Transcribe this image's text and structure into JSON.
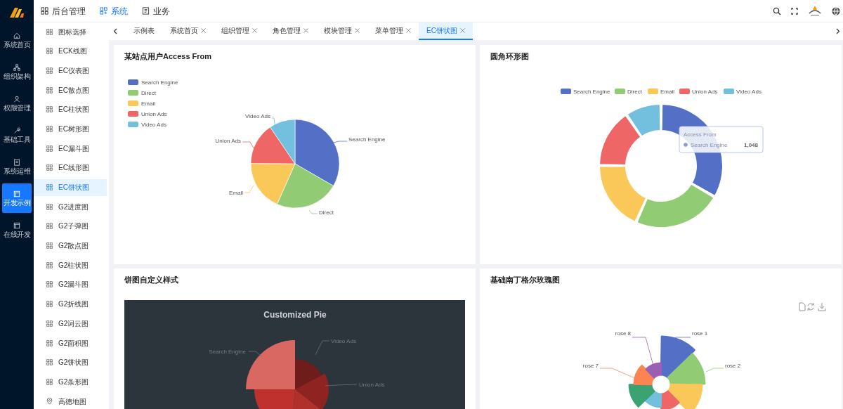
{
  "header": {
    "nav": [
      {
        "label": "后台管理",
        "selected": false
      },
      {
        "label": "系统",
        "selected": true
      },
      {
        "label": "业务",
        "selected": false
      }
    ]
  },
  "sidebar": {
    "items": [
      {
        "label": "系统首页",
        "selected": false
      },
      {
        "label": "组织架构",
        "selected": false
      },
      {
        "label": "权限管理",
        "selected": false
      },
      {
        "label": "基础工具",
        "selected": false
      },
      {
        "label": "系统运维",
        "selected": false
      },
      {
        "label": "开发示例",
        "selected": true
      },
      {
        "label": "在线开发",
        "selected": false
      }
    ]
  },
  "submenu": {
    "items": [
      {
        "label": "图标选择",
        "kind": "chart",
        "selected": false
      },
      {
        "label": "ECK线图",
        "kind": "chart",
        "selected": false
      },
      {
        "label": "EC仪表图",
        "kind": "chart",
        "selected": false
      },
      {
        "label": "EC散点图",
        "kind": "chart",
        "selected": false
      },
      {
        "label": "EC柱状图",
        "kind": "chart",
        "selected": false
      },
      {
        "label": "EC树形图",
        "kind": "chart",
        "selected": false
      },
      {
        "label": "EC漏斗图",
        "kind": "chart",
        "selected": false
      },
      {
        "label": "EC线形图",
        "kind": "chart",
        "selected": false
      },
      {
        "label": "EC饼状图",
        "kind": "chart",
        "selected": true
      },
      {
        "label": "G2进度图",
        "kind": "chart",
        "selected": false
      },
      {
        "label": "G2子弹图",
        "kind": "chart",
        "selected": false
      },
      {
        "label": "G2散点图",
        "kind": "chart",
        "selected": false
      },
      {
        "label": "G2柱状图",
        "kind": "chart",
        "selected": false
      },
      {
        "label": "G2漏斗图",
        "kind": "chart",
        "selected": false
      },
      {
        "label": "G2折线图",
        "kind": "chart",
        "selected": false
      },
      {
        "label": "G2词云图",
        "kind": "chart",
        "selected": false
      },
      {
        "label": "G2面积图",
        "kind": "chart",
        "selected": false
      },
      {
        "label": "G2饼状图",
        "kind": "chart",
        "selected": false
      },
      {
        "label": "G2条形图",
        "kind": "chart",
        "selected": false
      },
      {
        "label": "高德地图",
        "kind": "map",
        "selected": false
      }
    ]
  },
  "tabs": [
    {
      "label": "示例表",
      "closable": false,
      "selected": false
    },
    {
      "label": "系统首页",
      "closable": true,
      "selected": false
    },
    {
      "label": "组织管理",
      "closable": true,
      "selected": false
    },
    {
      "label": "角色管理",
      "closable": true,
      "selected": false
    },
    {
      "label": "模块管理",
      "closable": true,
      "selected": false
    },
    {
      "label": "菜单管理",
      "closable": true,
      "selected": false
    },
    {
      "label": "EC饼状图",
      "closable": true,
      "selected": true
    }
  ],
  "cards": [
    {
      "kind": "pie",
      "title": "某站点用户Access From",
      "slices": [
        {
          "name": "Search Engine",
          "label": "Search Engine",
          "color": "#5470c6"
        },
        {
          "name": "Direct",
          "label": "Direct",
          "color": "#91cc75"
        },
        {
          "name": "Email",
          "label": "Email",
          "color": "#fac858"
        },
        {
          "name": "Union Ads",
          "label": "Union Ads",
          "color": "#ee6666"
        },
        {
          "name": "Video Ads",
          "label": "Video Ads",
          "color": "#73c0de"
        }
      ]
    },
    {
      "kind": "donut",
      "title": "圆角环形图",
      "legend": [
        {
          "label": "Search Engine",
          "color": "#5470c6"
        },
        {
          "label": "Direct",
          "color": "#91cc75"
        },
        {
          "label": "Email",
          "color": "#fac858"
        },
        {
          "label": "Union Ads",
          "color": "#ee6666"
        },
        {
          "label": "Video Ads",
          "color": "#73c0de"
        }
      ],
      "tooltip": {
        "title": "Access From",
        "name": "Search Engine",
        "value": "1,048"
      }
    },
    {
      "kind": "custom",
      "title": "饼图自定义样式",
      "chart_title": "Customized Pie",
      "labels": [
        "Search Engine",
        "Video Ads",
        "Union Ads"
      ]
    },
    {
      "kind": "rose",
      "title": "基础南丁格尔玫瑰图",
      "sectors": [
        {
          "label": "rose 1",
          "color": "#5470c6"
        },
        {
          "label": "rose 2",
          "color": "#91cc75"
        },
        {
          "color": "#fac858"
        },
        {
          "color": "#ee6666"
        },
        {
          "color": "#73c0de"
        },
        {
          "color": "#3ba272"
        },
        {
          "label": "rose 7",
          "color": "#fc8452"
        },
        {
          "label": "rose 8",
          "color": "#9a60b4"
        }
      ]
    }
  ]
}
